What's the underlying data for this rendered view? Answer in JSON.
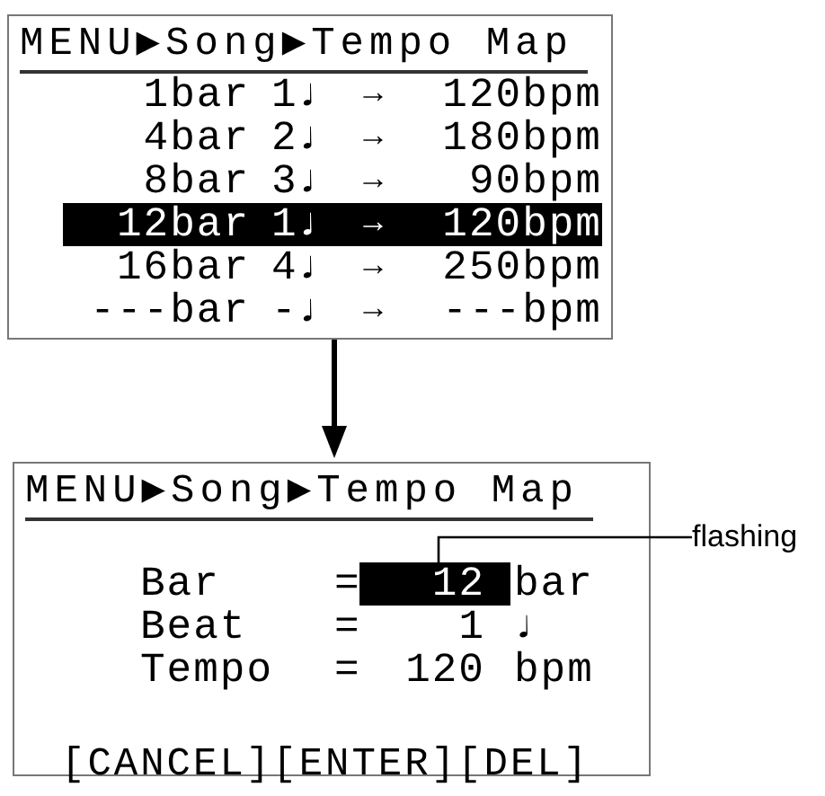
{
  "list_screen": {
    "title": "MENU▶Song▶Tempo Map",
    "rows": [
      {
        "bar": "1bar",
        "beat": "1♩",
        "arrow": "→",
        "tempo": "120bpm",
        "selected": false
      },
      {
        "bar": "4bar",
        "beat": "2♩",
        "arrow": "→",
        "tempo": "180bpm",
        "selected": false
      },
      {
        "bar": "8bar",
        "beat": "3♩",
        "arrow": "→",
        "tempo": "90bpm",
        "selected": false
      },
      {
        "bar": "12bar",
        "beat": "1♩",
        "arrow": "→",
        "tempo": "120bpm",
        "selected": true
      },
      {
        "bar": "16bar",
        "beat": "4♩",
        "arrow": "→",
        "tempo": "250bpm",
        "selected": false
      },
      {
        "bar": "---bar",
        "beat": "-♩",
        "arrow": "→",
        "tempo": "---bpm",
        "selected": false
      }
    ]
  },
  "edit_screen": {
    "title": "MENU▶Song▶Tempo Map",
    "fields": [
      {
        "label": "Bar",
        "equals": "=",
        "value": "12",
        "unit": "bar",
        "flashing": true
      },
      {
        "label": "Beat",
        "equals": "=",
        "value": "1",
        "unit": "♩",
        "flashing": false
      },
      {
        "label": "Tempo",
        "equals": "=",
        "value": "120",
        "unit": "bpm",
        "flashing": false
      }
    ],
    "buttons": [
      "[CANCEL]",
      "[ENTER]",
      "[DEL]"
    ]
  },
  "annotation": "flashing"
}
